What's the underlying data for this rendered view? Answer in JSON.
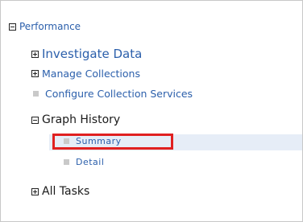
{
  "tree": {
    "root": {
      "label": "Performance",
      "toggle": "collapse"
    },
    "items": [
      {
        "label": "Investigate Data",
        "toggle": "expand"
      },
      {
        "label": "Manage Collections",
        "toggle": "expand"
      },
      {
        "label": "Configure Collection Services",
        "toggle": "none"
      },
      {
        "label": "Graph History",
        "toggle": "collapse"
      },
      {
        "label": "Summary",
        "toggle": "none",
        "selected": true
      },
      {
        "label": "Detail",
        "toggle": "none"
      },
      {
        "label": "All Tasks",
        "toggle": "expand"
      }
    ]
  },
  "colors": {
    "link": "#2b5fab",
    "dark_text": "#1a1a1a",
    "selection": "#e6edf7",
    "highlight_box": "#e02020"
  }
}
